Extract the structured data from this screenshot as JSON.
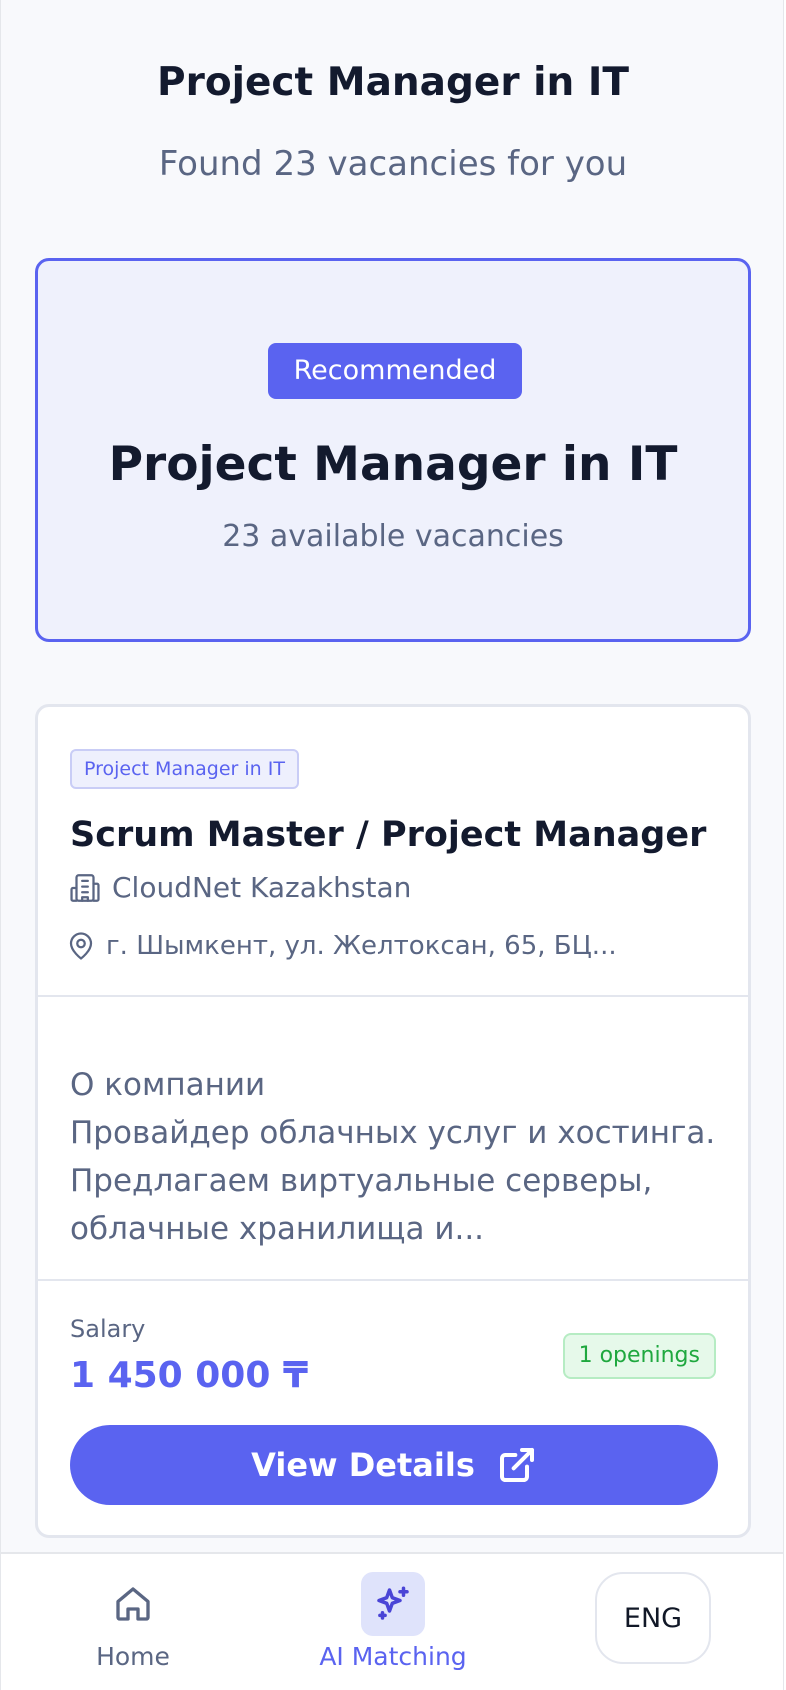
{
  "header": {
    "title": "Project Manager in IT",
    "subtitle": "Found 23 vacancies for you"
  },
  "recommended": {
    "badge": "Recommended",
    "title": "Project Manager in IT",
    "subtitle": "23 available vacancies"
  },
  "job": {
    "tag": "Project Manager in IT",
    "title": "Scrum Master / Project Manager",
    "company": "CloudNet Kazakhstan",
    "location": "г. Шымкент, ул. Желтоксан, 65, БЦ...",
    "description_heading": "О компании",
    "description": "Провайдер облачных услуг и хостинга. Предлагаем виртуальные серверы, облачные хранилища и...",
    "salary_label": "Salary",
    "salary_value": "1 450 000 ₸",
    "openings": "1 openings",
    "button_label": "View Details",
    "icons": {
      "company": "building-icon",
      "location": "map-pin-icon",
      "button": "external-link-icon"
    }
  },
  "nav": {
    "home_label": "Home",
    "ai_label": "AI Matching",
    "lang_label": "ENG",
    "active": "ai_matching",
    "icons": {
      "home": "home-icon",
      "ai": "sparkles-icon"
    }
  },
  "colors": {
    "accent": "#5a63f0",
    "accent_light": "#eff1fc",
    "text_dark": "#131a2e",
    "text_muted": "#5a6683",
    "success": "#1fa83f",
    "success_bg": "#e6f9ea",
    "background": "#f8f9fc"
  }
}
